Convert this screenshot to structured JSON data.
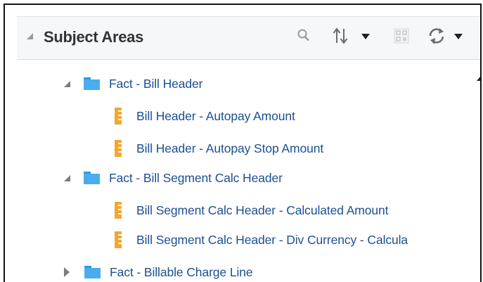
{
  "panel": {
    "title": "Subject Areas",
    "toolbar": {
      "search_icon": "search-icon",
      "sort_icon": "sort-icon",
      "disabled_icon": "qr-icon",
      "refresh_icon": "refresh-icon"
    }
  },
  "tree": {
    "items": [
      {
        "label": "Fact - Bill Header",
        "type": "folder",
        "state": "expanded"
      },
      {
        "label": "Bill Header - Autopay Amount",
        "type": "measure"
      },
      {
        "label": "Bill Header - Autopay Stop Amount",
        "type": "measure"
      },
      {
        "label": "Fact - Bill Segment Calc Header",
        "type": "folder",
        "state": "expanded"
      },
      {
        "label": "Bill Segment Calc Header - Calculated Amount",
        "type": "measure"
      },
      {
        "label": "Bill Segment Calc Header - Div Currency - Calcula",
        "type": "measure"
      },
      {
        "label": "Fact - Billable Charge Line",
        "type": "folder",
        "state": "collapsed"
      }
    ]
  },
  "colors": {
    "link": "#1d4f91",
    "folder": "#4aacef",
    "measure": "#f2a731",
    "header_bg": "#f6f7f9"
  }
}
